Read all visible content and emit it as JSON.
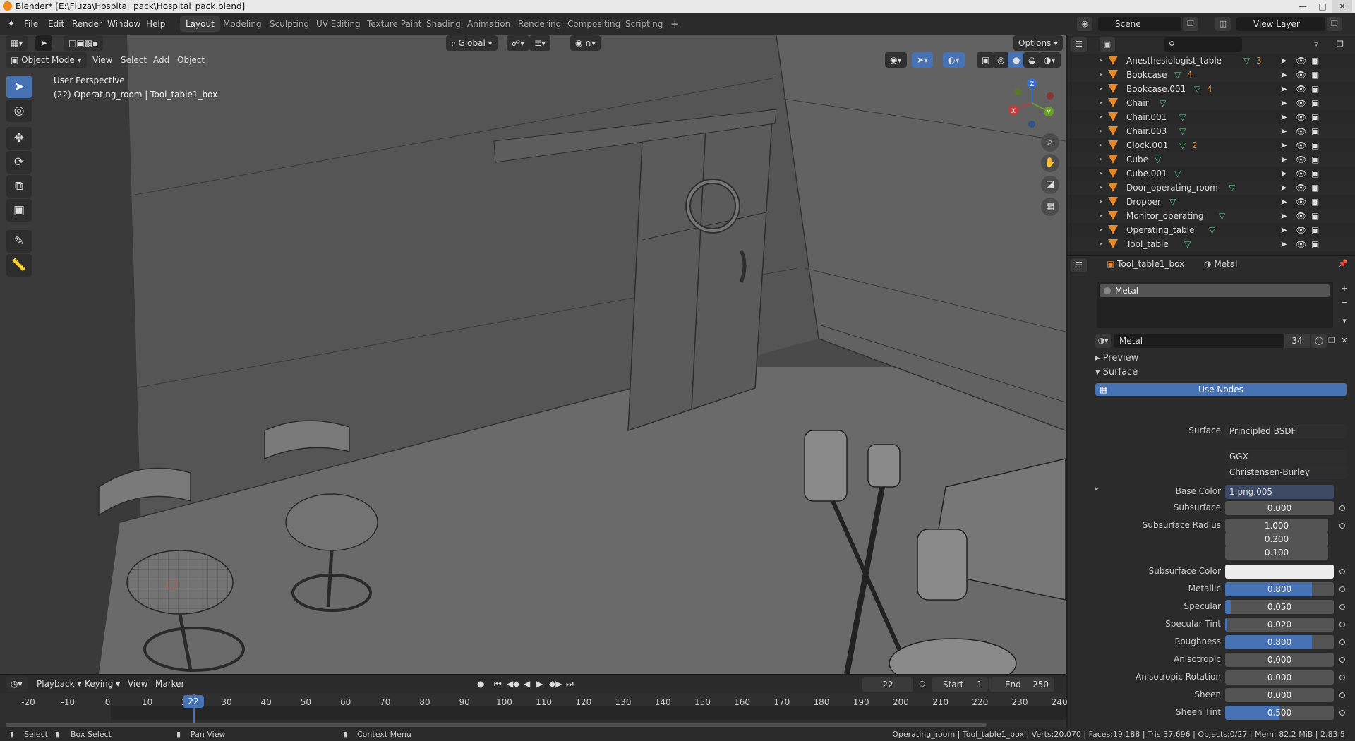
{
  "window": {
    "title": "Blender* [E:\\Fluza\\Hospital_pack\\Hospital_pack.blend]"
  },
  "menu": [
    "File",
    "Edit",
    "Render",
    "Window",
    "Help"
  ],
  "workspaces": [
    "Layout",
    "Modeling",
    "Sculpting",
    "UV Editing",
    "Texture Paint",
    "Shading",
    "Animation",
    "Rendering",
    "Compositing",
    "Scripting"
  ],
  "active_workspace": "Layout",
  "scene": {
    "label": "Scene",
    "view_layer": "View Layer"
  },
  "toolbar": {
    "orientation": "Global",
    "options": "Options"
  },
  "viewport": {
    "mode": "Object Mode",
    "menus": [
      "View",
      "Select",
      "Add",
      "Object"
    ],
    "perspective": "User Perspective",
    "info": "(22) Operating_room | Tool_table1_box",
    "gizmo": {
      "x": "X",
      "y": "Y",
      "z": "Z"
    }
  },
  "outliner": {
    "items": [
      {
        "name": "Anesthesiologist_table",
        "badge": "3"
      },
      {
        "name": "Bookcase",
        "badge": "4"
      },
      {
        "name": "Bookcase.001",
        "badge": "4"
      },
      {
        "name": "Chair",
        "badge": ""
      },
      {
        "name": "Chair.001",
        "badge": ""
      },
      {
        "name": "Chair.003",
        "badge": ""
      },
      {
        "name": "Clock.001",
        "badge": "2"
      },
      {
        "name": "Cube",
        "badge": ""
      },
      {
        "name": "Cube.001",
        "badge": ""
      },
      {
        "name": "Door_operating_room",
        "badge": ""
      },
      {
        "name": "Dropper",
        "badge": ""
      },
      {
        "name": "Monitor_operating",
        "badge": ""
      },
      {
        "name": "Operating_table",
        "badge": ""
      },
      {
        "name": "Tool_table",
        "badge": ""
      }
    ]
  },
  "properties": {
    "object": "Tool_table1_box",
    "material_tab": "Metal",
    "slot": "Metal",
    "material_name": "Metal",
    "users": "34",
    "panel_preview": "Preview",
    "panel_surface": "Surface",
    "use_nodes": "Use Nodes",
    "surface_label": "Surface",
    "surface_value": "Principled BSDF",
    "distribution": "GGX",
    "subsurface_method": "Christensen-Burley",
    "base_color_label": "Base Color",
    "base_color_value": "1.png.005",
    "fields": [
      {
        "label": "Subsurface",
        "value": "0.000",
        "fraction": 0.0
      },
      {
        "label": "Subsurface Radius",
        "value": "1.000",
        "fraction": 0.0
      },
      {
        "label": "",
        "value": "0.200",
        "fraction": 0.0
      },
      {
        "label": "",
        "value": "0.100",
        "fraction": 0.0
      },
      {
        "label": "Subsurface Color",
        "value": "",
        "fraction": 0.0
      },
      {
        "label": "Metallic",
        "value": "0.800",
        "fraction": 0.8
      },
      {
        "label": "Specular",
        "value": "0.050",
        "fraction": 0.05
      },
      {
        "label": "Specular Tint",
        "value": "0.020",
        "fraction": 0.02
      },
      {
        "label": "Roughness",
        "value": "0.800",
        "fraction": 0.8
      },
      {
        "label": "Anisotropic",
        "value": "0.000",
        "fraction": 0.0
      },
      {
        "label": "Anisotropic Rotation",
        "value": "0.000",
        "fraction": 0.0
      },
      {
        "label": "Sheen",
        "value": "0.000",
        "fraction": 0.0
      },
      {
        "label": "Sheen Tint",
        "value": "0.500",
        "fraction": 0.5
      }
    ]
  },
  "timeline": {
    "menus": [
      "Playback",
      "Keying",
      "View",
      "Marker"
    ],
    "current_frame": "22",
    "start_label": "Start",
    "start": "1",
    "end_label": "End",
    "end": "250",
    "ticks": [
      "-20",
      "-10",
      "0",
      "10",
      "20",
      "30",
      "40",
      "50",
      "60",
      "70",
      "80",
      "90",
      "100",
      "110",
      "120",
      "130",
      "140",
      "150",
      "160",
      "170",
      "180",
      "190",
      "200",
      "210",
      "220",
      "230",
      "240"
    ]
  },
  "statusbar": {
    "select": "Select",
    "box_select": "Box Select",
    "pan_view": "Pan View",
    "context_menu": "Context Menu",
    "stats": "Operating_room | Tool_table1_box | Verts:20,070 | Faces:19,188 | Tris:37,696 | Objects:0/27 | Mem: 82.2 MiB | 2.83.5"
  },
  "colors": {
    "accent": "#4772b3",
    "mesh": "#e8892c",
    "material": "#5dbb8b"
  }
}
